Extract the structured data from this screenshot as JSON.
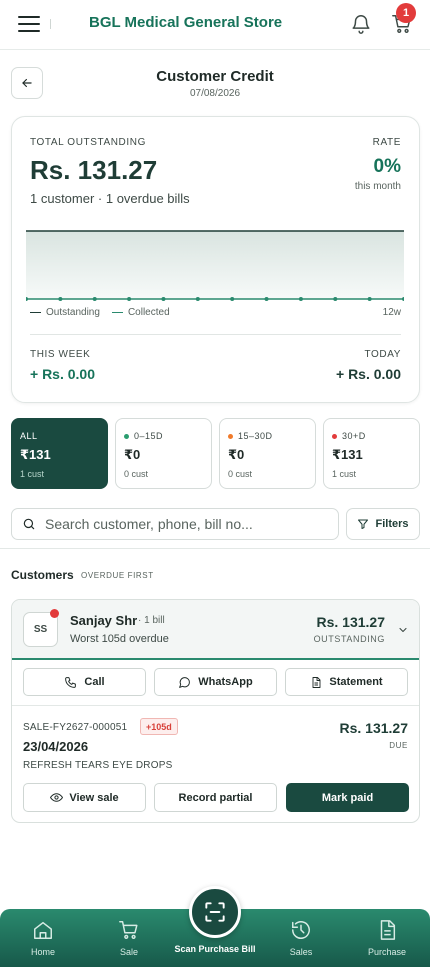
{
  "topbar": {
    "store_name": "BGL Medical General Store",
    "cart_count": "1"
  },
  "header": {
    "title": "Customer Credit",
    "date": "07/08/2026"
  },
  "summary": {
    "total_label": "TOTAL OUTSTANDING",
    "total_value": "Rs. 131.27",
    "total_sub": "1 customer · 1 overdue bills",
    "rate_label": "RATE",
    "rate_value": "0%",
    "rate_sub": "this month",
    "legend_outstanding": "Outstanding",
    "legend_collected": "Collected",
    "legend_range": "12w",
    "week_label": "THIS WEEK",
    "week_value": "+ Rs. 0.00",
    "today_label": "TODAY",
    "today_value": "+ Rs. 0.00"
  },
  "chart_data": {
    "type": "line",
    "series": [
      {
        "name": "Outstanding",
        "values": [
          131.27,
          131.27,
          131.27,
          131.27,
          131.27,
          131.27,
          131.27,
          131.27,
          131.27,
          131.27,
          131.27,
          131.27
        ]
      },
      {
        "name": "Collected",
        "values": [
          0,
          0,
          0,
          0,
          0,
          0,
          0,
          0,
          0,
          0,
          0,
          0
        ]
      }
    ],
    "xlabel": "",
    "ylabel": "",
    "grid": true
  },
  "aging_tiles": [
    {
      "label": "ALL",
      "value": "₹131",
      "sub": "1 cust",
      "dot": "",
      "active": true
    },
    {
      "label": "0–15D",
      "value": "₹0",
      "sub": "0 cust",
      "dot": "#2a9d6f",
      "active": false
    },
    {
      "label": "15–30D",
      "value": "₹0",
      "sub": "0 cust",
      "dot": "#f07a2a",
      "active": false
    },
    {
      "label": "30+D",
      "value": "₹131",
      "sub": "1 cust",
      "dot": "#e23b3b",
      "active": false
    }
  ],
  "search": {
    "placeholder": "Search customer, phone, bill no...",
    "filters_label": "Filters"
  },
  "customers": {
    "title": "Customers",
    "sort_label": "OVERDUE FIRST"
  },
  "customer_card": {
    "initials": "SS",
    "name": "Sanjay Shr",
    "bills": "· 1 bill",
    "overdue": "Worst 105d overdue",
    "amount": "Rs. 131.27",
    "amount_label": "OUTSTANDING",
    "actions": {
      "call": "Call",
      "whatsapp": "WhatsApp",
      "statement": "Statement"
    },
    "bill": {
      "id": "SALE-FY2627-000051",
      "badge": "+105d",
      "date": "23/04/2026",
      "item": "REFRESH TEARS EYE DROPS",
      "amount": "Rs. 131.27",
      "due_label": "DUE",
      "view_sale": "View sale",
      "record_partial": "Record partial",
      "mark_paid": "Mark paid"
    }
  },
  "bottom_nav": {
    "home": "Home",
    "sale": "Sale",
    "scan": "Scan Purchase Bill",
    "sales": "Sales",
    "purchase": "Purchase"
  },
  "colors": {
    "brand": "#17735a",
    "dark_brand": "#1a4a40",
    "overdue": "#e23b3b"
  }
}
